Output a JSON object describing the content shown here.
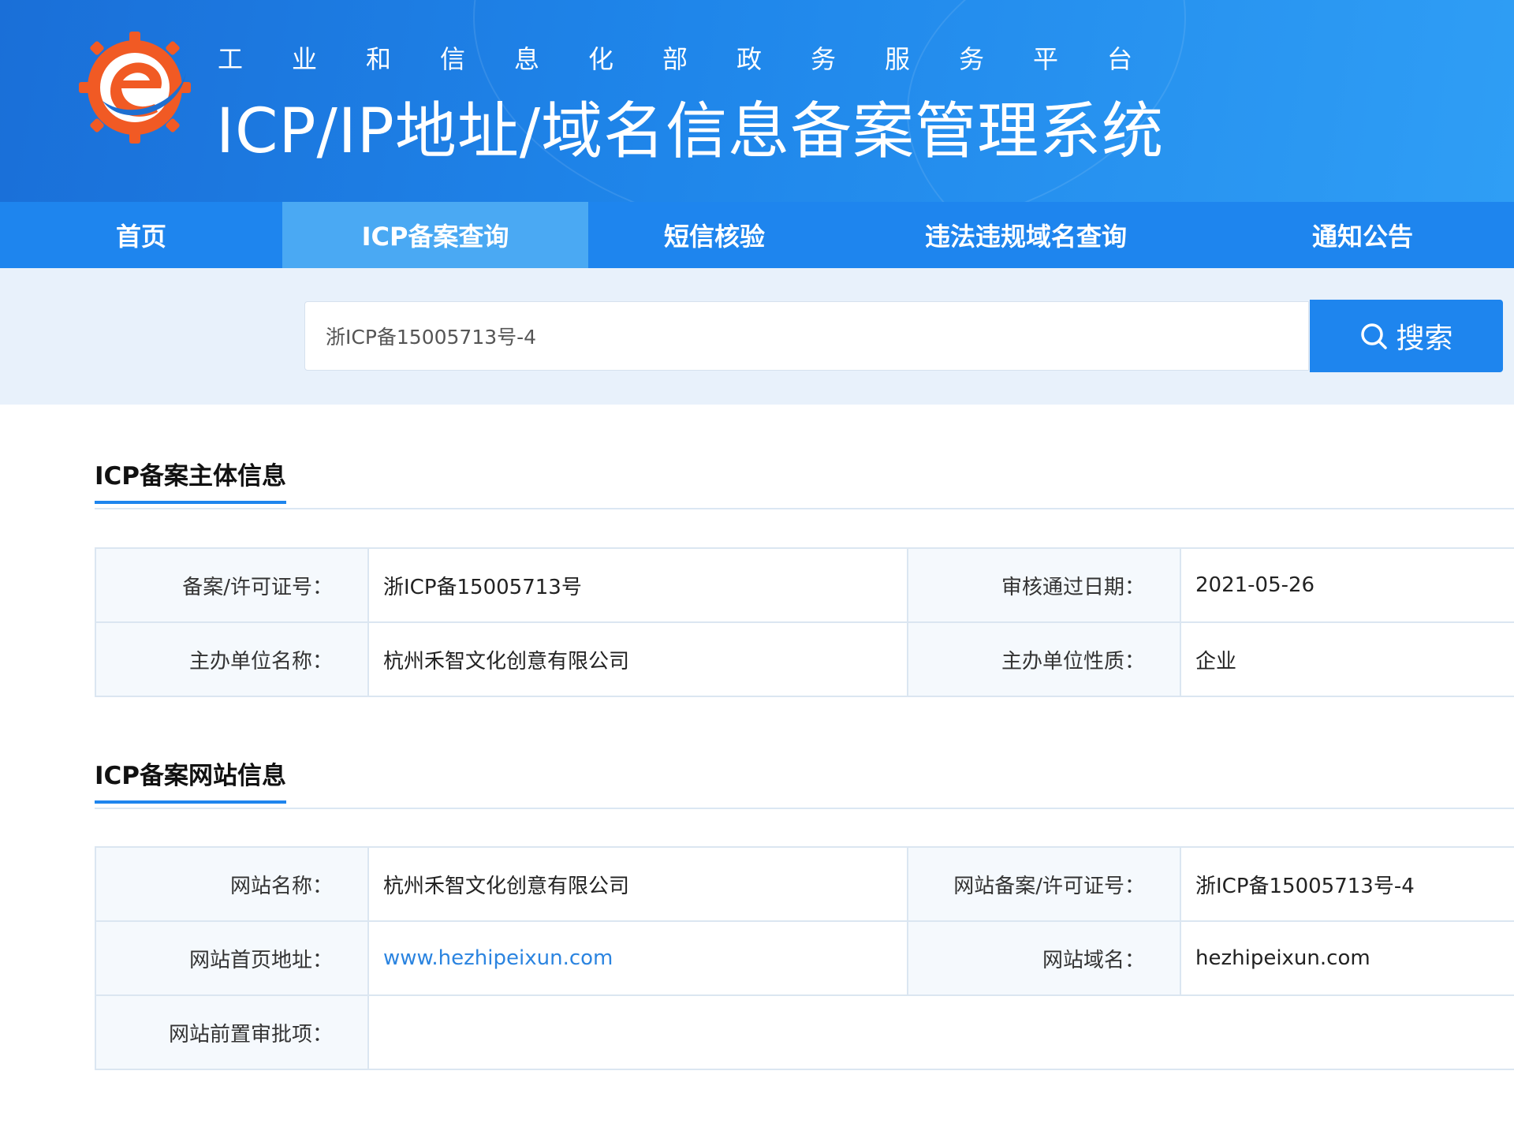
{
  "header": {
    "subtitle": "工业和信息化部政务服务平台",
    "title": "ICP/IP地址/域名信息备案管理系统"
  },
  "nav": {
    "items": [
      {
        "label": "首页",
        "active": false
      },
      {
        "label": "ICP备案查询",
        "active": true
      },
      {
        "label": "短信核验",
        "active": false
      },
      {
        "label": "违法违规域名查询",
        "active": false
      },
      {
        "label": "通知公告",
        "active": false
      }
    ]
  },
  "search": {
    "value": "浙ICP备15005713号-4",
    "button_label": "搜索"
  },
  "subject_section": {
    "title": "ICP备案主体信息",
    "rows": [
      {
        "label1": "备案/许可证号：",
        "value1": "浙ICP备15005713号",
        "label2": "审核通过日期：",
        "value2": "2021-05-26"
      },
      {
        "label1": "主办单位名称：",
        "value1": "杭州禾智文化创意有限公司",
        "label2": "主办单位性质：",
        "value2": "企业"
      }
    ]
  },
  "website_section": {
    "title": "ICP备案网站信息",
    "rows": [
      {
        "label1": "网站名称：",
        "value1": "杭州禾智文化创意有限公司",
        "label2": "网站备案/许可证号：",
        "value2": "浙ICP备15005713号-4"
      },
      {
        "label1": "网站首页地址：",
        "value1": "www.hezhipeixun.com",
        "label2": "网站域名：",
        "value2": "hezhipeixun.com"
      }
    ],
    "pre_approval_label": "网站前置审批项：",
    "pre_approval_value": ""
  },
  "colors": {
    "brand_blue": "#1e85ee",
    "nav_active": "#4aa9f3",
    "link": "#2b84e0",
    "logo_orange": "#f15a24"
  }
}
